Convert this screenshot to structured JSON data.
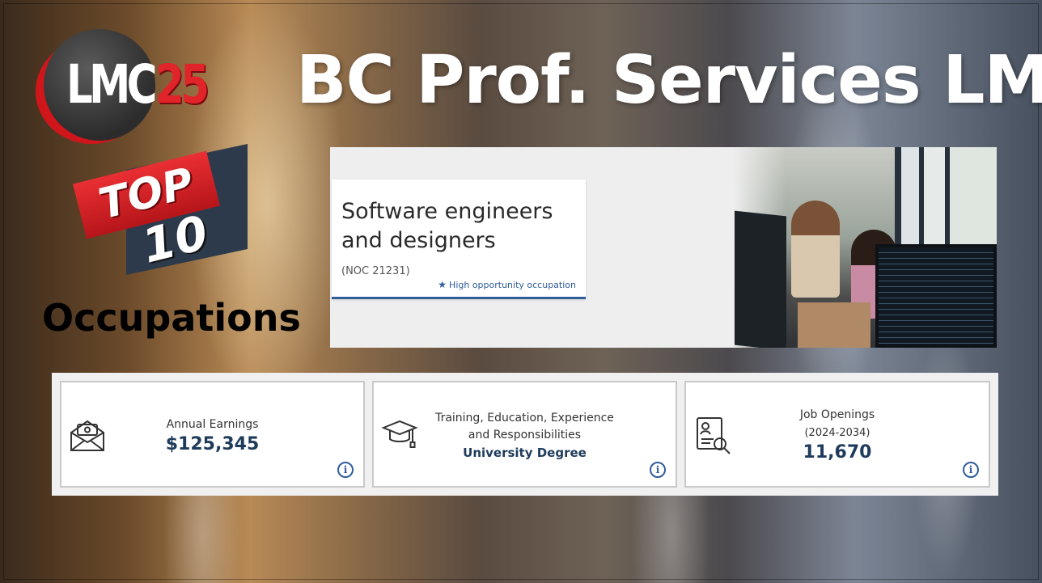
{
  "logo": {
    "lmc": "LMC",
    "number": "25"
  },
  "title": "BC Prof. Services LMI",
  "badge": {
    "top": "TOP",
    "number": "10"
  },
  "subtitle": "Occupations",
  "occupation": {
    "title": "Software engineers and designers",
    "noc": "(NOC 21231)",
    "tag": "High opportunity occupation",
    "tag_icon": "star-icon"
  },
  "stats": {
    "earnings": {
      "label": "Annual Earnings",
      "value": "$125,345",
      "icon": "money-envelope-icon"
    },
    "training": {
      "label": "Training, Education, Experience and Responsibilities",
      "value": "University Degree",
      "icon": "graduation-cap-icon"
    },
    "jobs": {
      "label": "Job Openings",
      "period": "(2024-2034)",
      "value": "11,670",
      "icon": "job-search-document-icon"
    },
    "info_glyph": "i"
  },
  "colors": {
    "accent_blue": "#2f5d9a",
    "value_navy": "#1f3b5c",
    "brand_red": "#e0242a"
  }
}
